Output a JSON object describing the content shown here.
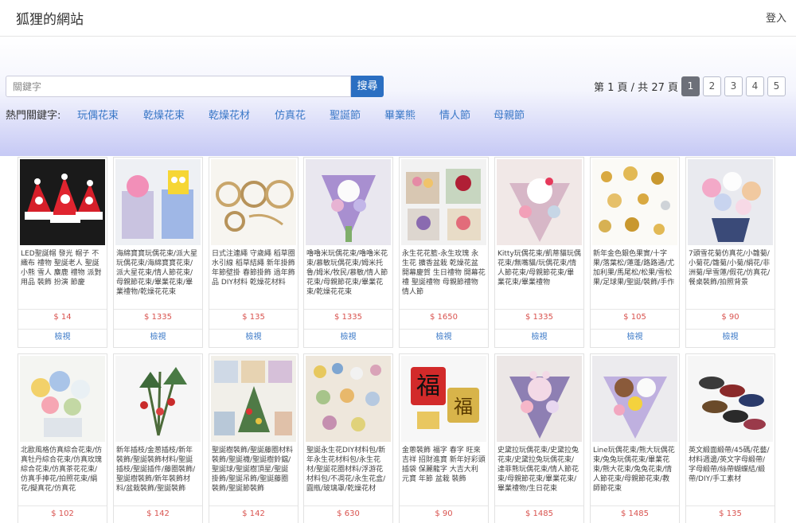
{
  "site": {
    "title": "狐狸的網站",
    "login_label": "登入"
  },
  "search": {
    "placeholder": "關鍵字",
    "button_label": "搜尋"
  },
  "pagination": {
    "info": "第 1 頁 / 共 27 頁",
    "pages": [
      "1",
      "2",
      "3",
      "4",
      "5"
    ],
    "current": "1"
  },
  "keywords": {
    "label": "熱門關鍵字:",
    "items": [
      "玩偶花束",
      "乾燥花束",
      "乾燥花材",
      "仿真花",
      "聖誕節",
      "畢業熊",
      "情人節",
      "母親節"
    ]
  },
  "colors": {
    "link": "#3a78c7",
    "price": "#d9534f",
    "search_button": "#2b6fc2",
    "active_page": "#6d7079"
  },
  "products": [
    {
      "desc": "LED聖誕帽 發光 帽子 不織布 禮物 聖誕老人 聖誕小熊 雪人 麋鹿 禮物 派對用品 裝飾 扮演 節慶",
      "price": "$ 14",
      "view": "檢視",
      "thumb": "santa-hats",
      "thumb_text": ""
    },
    {
      "desc": "海綿寶寶玩偶花束/派大星玩偶花束/海綿寶寶花束/派大星花束/情人節花束/母親節花束/畢業花束/畢業禮物/乾燥花花束",
      "price": "$ 1335",
      "view": "檢視",
      "thumb": "spongebob-bouquet",
      "thumb_text": ""
    },
    {
      "desc": "日式注連繩 守歲繩 稻草圈 水引線 稻草結繩 新年掛飾 年節壁掛 春節掛飾 過年飾品 DIY材料 乾燥花材料",
      "price": "$ 135",
      "view": "檢視",
      "thumb": "straw-rings",
      "thumb_text": ""
    },
    {
      "desc": "嚕嚕米玩偶花束/嚕嚕米花束/慕敏玩偶花束/姆米托魯/姆米/牧民/慕敏/情人節花束/母親節花束/畢業花束/乾燥花花束",
      "price": "$ 1335",
      "view": "檢視",
      "thumb": "moomin-bouquet",
      "thumb_text": ""
    },
    {
      "desc": "永生花花籃-永生玫瑰 永生花 擴香盆栽 乾燥花盆 開幕慶賀 生日禮物 開幕花禮 聖誕禮物 母親節禮物 情人節",
      "price": "$ 1650",
      "view": "檢視",
      "thumb": "flower-baskets",
      "thumb_text": ""
    },
    {
      "desc": "Kitty玩偶花束/凱蒂貓玩偶花束/無嘴貓/玩偶花束/情人節花束/母親節花束/畢業花束/畢業禮物",
      "price": "$ 1335",
      "view": "檢視",
      "thumb": "kitty-bouquet",
      "thumb_text": ""
    },
    {
      "desc": "新年金色銀色果實/十字果/落葉松/蓮蓬/路路通/尤加利果/馬尾松/松果/雪松果/足球果/聖誕/裝飾/手作",
      "price": "$ 105",
      "view": "檢視",
      "thumb": "gold-fruits",
      "thumb_text": ""
    },
    {
      "desc": "7頭雪花菊仿真花/小雛菊/小菊花/雛菊/小菊/絹花/非洲菊/旱雪蓮/假花/仿真花/餐桌裝飾/拍照背景",
      "price": "$ 90",
      "view": "檢視",
      "thumb": "daisy-pot",
      "thumb_text": ""
    },
    {
      "desc": "北歐風格仿真綜合花束/仿真牡丹綜合花束/仿真玫瑰綜合花束/仿真茶花花束/仿真手捧花/拍照花束/絹花/擬真花/仿真花",
      "price": "$ 102",
      "view": "檢視",
      "thumb": "nordic-bouquet",
      "thumb_text": ""
    },
    {
      "desc": "新年插枝/金葱插枝/新年裝飾/聖誕裝飾材料/聖誕插枝/聖誕插件/藤圈裝飾/聖誕樹裝飾/新年裝飾材料/盆栽裝飾/聖誕裝飾",
      "price": "$ 142",
      "view": "檢視",
      "thumb": "pine-picks",
      "thumb_text": ""
    },
    {
      "desc": "聖誕樹裝飾/聖誕藤圈材料裝飾/聖誕襪/聖誕樹鈴鐺/聖誕球/聖誕樹頂星/聖誕掛飾/聖誕吊飾/聖誕藤圈裝飾/聖誕節裝飾",
      "price": "$ 142",
      "view": "檢視",
      "thumb": "xmas-ornaments",
      "thumb_text": ""
    },
    {
      "desc": "聖誕永生花DIY材料包/新年永生花材料包/永生花材/聖誕花圈材料/浮游花材料包/不凋花/永生花盒/圓瓶/玻璃罩/乾燥花材",
      "price": "$ 630",
      "view": "檢視",
      "thumb": "diy-kit",
      "thumb_text": ""
    },
    {
      "desc": "金蔥裝飾 福字 春字 旺來 吉祥 招財進寶 新年好彩頭 插袋 保麗龍字 大吉大利 元寶 年節 盆栽 裝飾",
      "price": "$ 90",
      "view": "檢視",
      "thumb": "fu-characters",
      "thumb_text": "福"
    },
    {
      "desc": "史黛拉玩偶花束/史黛拉兔花束/史黛拉兔玩偶花束/達菲熊玩偶花束/情人節花束/母親節花束/畢業花束/畢業禮物/生日花束",
      "price": "$ 1485",
      "view": "檢視",
      "thumb": "stella-bouquet",
      "thumb_text": ""
    },
    {
      "desc": "Line玩偶花束/熊大玩偶花束/兔兔玩偶花束/畢業花束/熊大花束/兔兔花束/情人節花束/母親節花束/教師節花束",
      "price": "$ 1485",
      "view": "檢視",
      "thumb": "line-bouquet",
      "thumb_text": ""
    },
    {
      "desc": "英文緞面緞帶/45碼/花藝/材料週邊/英文字母緞帶/字母緞帶/絲帶蝴蝶結/緞帶/DIY/手工素材",
      "price": "$ 135",
      "view": "檢視",
      "thumb": "ribbon-rolls",
      "thumb_text": ""
    }
  ]
}
